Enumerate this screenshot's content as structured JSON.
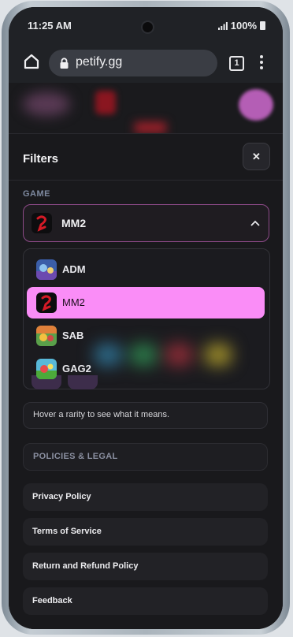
{
  "status_bar": {
    "time": "11:25 AM",
    "battery": "100%"
  },
  "browser": {
    "url": "petify.gg",
    "tab_count": "1"
  },
  "filters": {
    "title": "Filters",
    "close_icon": "✕",
    "game_section_label": "GAME",
    "selected_game": "MM2",
    "options": [
      {
        "label": "ADM",
        "icon": "adm-game-icon",
        "selected": false
      },
      {
        "label": "MM2",
        "icon": "mm2-game-icon",
        "selected": true
      },
      {
        "label": "SAB",
        "icon": "sab-game-icon",
        "selected": false
      },
      {
        "label": "GAG2",
        "icon": "gag2-game-icon",
        "selected": false
      }
    ],
    "rarity_hint": "Hover a rarity to see what it means."
  },
  "policies": {
    "header": "POLICIES & LEGAL",
    "links": [
      "Privacy Policy",
      "Terms of Service",
      "Return and Refund Policy",
      "Feedback"
    ]
  },
  "colors": {
    "accent": "#fa8df7",
    "select_border": "#8d4a88",
    "panel_bg": "#19191c"
  }
}
